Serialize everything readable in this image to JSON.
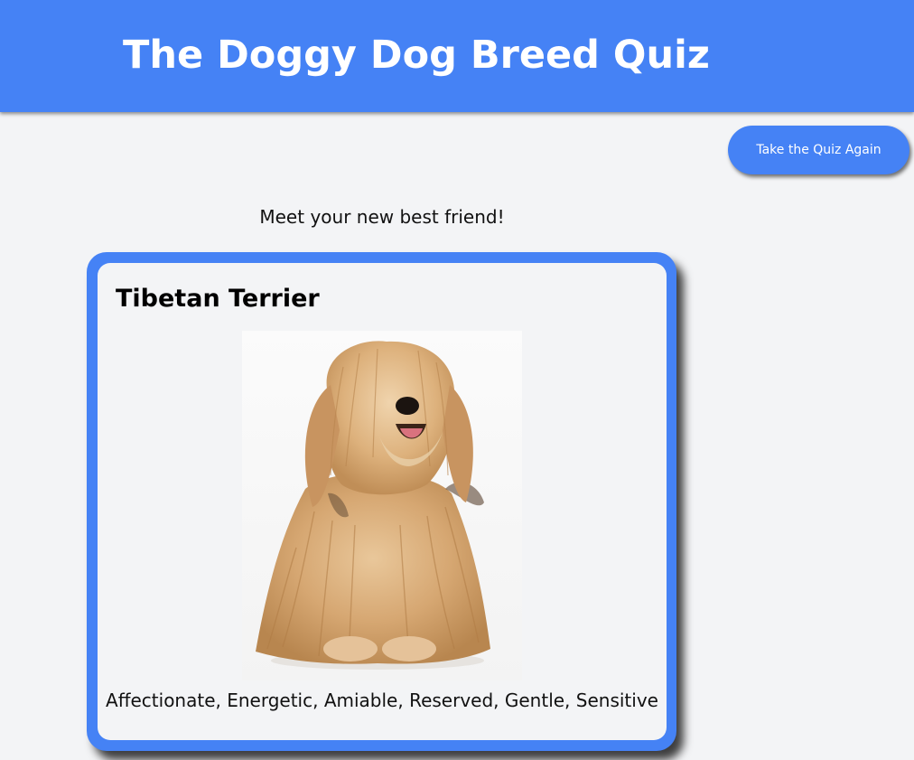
{
  "header": {
    "title": "The Doggy Dog Breed Quiz",
    "background": "#4582f5"
  },
  "actions": {
    "retake_label": "Take the Quiz Again"
  },
  "result": {
    "intro": "Meet your new best friend!",
    "breed_name": "Tibetan Terrier",
    "traits": "Affectionate, Energetic, Amiable, Reserved, Gentle, Sensitive",
    "photo_alt": "Tibetan Terrier"
  },
  "colors": {
    "accent": "#4582f5",
    "page_background": "#f3f4f6"
  }
}
